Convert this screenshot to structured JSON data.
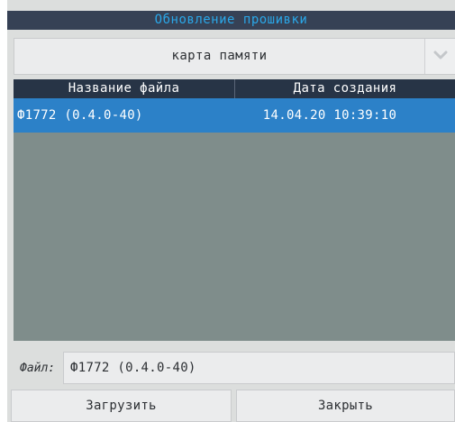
{
  "dialog": {
    "title": "Обновление прошивки"
  },
  "source": {
    "selected": "карта памяти"
  },
  "table": {
    "columns": [
      "Название файла",
      "Дата создания"
    ],
    "rows": [
      {
        "name": "Ф1772 (0.4.0-40)",
        "date": "14.04.20 10:39:10"
      }
    ]
  },
  "file": {
    "label": "Файл:",
    "value": "Ф1772 (0.4.0-40)"
  },
  "buttons": {
    "load": "Загрузить",
    "close": "Закрыть"
  },
  "colors": {
    "title_bg": "#364155",
    "title_text": "#2aa7e8",
    "header_bg": "#273446",
    "selected_row": "#2c81c8",
    "table_bg": "#7f8d8b"
  }
}
